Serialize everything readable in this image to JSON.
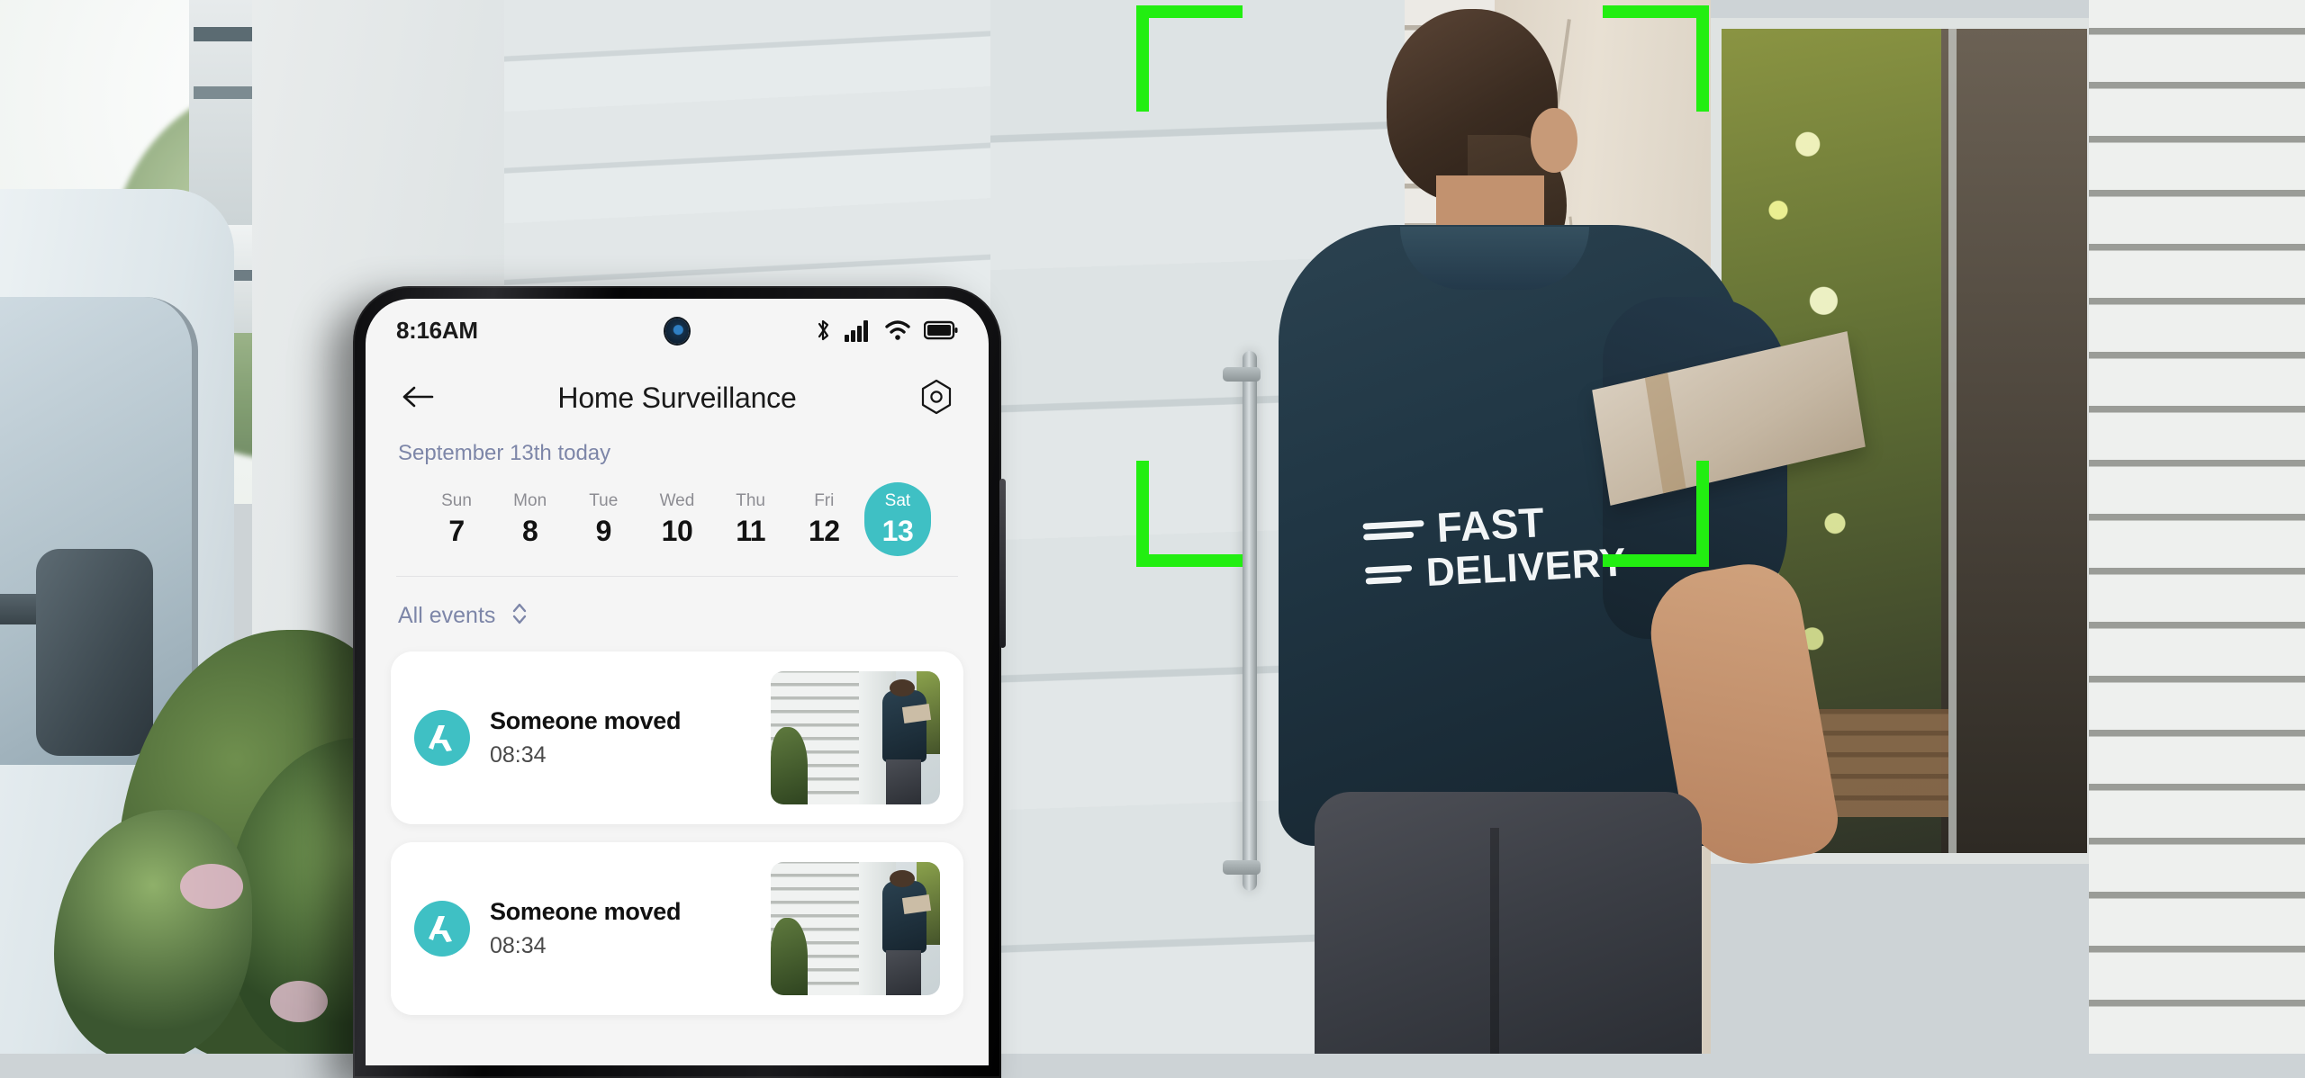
{
  "theme": {
    "accent": "#3fc0c4",
    "bracket_green": "#22ee11",
    "muted_text": "#7d86a8",
    "screen_bg": "#f5f5f5"
  },
  "phone": {
    "status_bar": {
      "time": "8:16AM",
      "icons": [
        "bluetooth-icon",
        "cellular-signal-icon",
        "wifi-icon",
        "battery-icon"
      ]
    },
    "app_bar": {
      "back_icon": "arrow-left-icon",
      "title": "Home Surveillance",
      "settings_icon": "hex-settings-icon"
    },
    "date_header": "September 13th  today",
    "day_strip": [
      {
        "dow": "Sun",
        "dom": "7",
        "selected": false
      },
      {
        "dow": "Mon",
        "dom": "8",
        "selected": false
      },
      {
        "dow": "Tue",
        "dom": "9",
        "selected": false
      },
      {
        "dow": "Wed",
        "dom": "10",
        "selected": false
      },
      {
        "dow": "Thu",
        "dom": "11",
        "selected": false
      },
      {
        "dow": "Fri",
        "dom": "12",
        "selected": false
      },
      {
        "dow": "Sat",
        "dom": "13",
        "selected": true
      }
    ],
    "filter": {
      "label": "All events",
      "icon": "chevron-up-down-icon"
    },
    "events": [
      {
        "icon": "motion-walk-icon",
        "title": "Someone moved",
        "time": "08:34",
        "thumbnail": "door-camera-snapshot"
      },
      {
        "icon": "motion-walk-icon",
        "title": "Someone moved",
        "time": "08:34",
        "thumbnail": "door-camera-snapshot"
      }
    ]
  },
  "background_scene": {
    "description": "Delivery courier at a house door handing a parcel through a window",
    "shirt_logo_line1": "FAST",
    "shirt_logo_line2": "DELIVERY",
    "detection_brackets": [
      "top-left",
      "top-right",
      "bottom-left",
      "bottom-right"
    ]
  }
}
